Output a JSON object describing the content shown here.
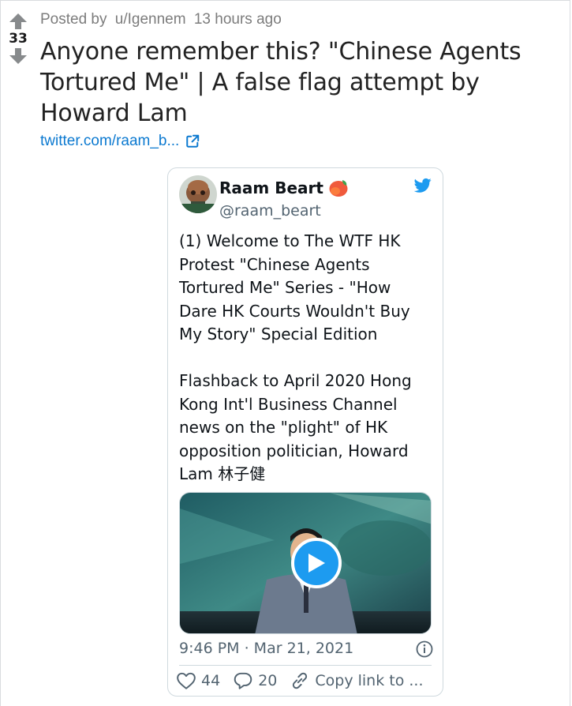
{
  "post": {
    "score": "33",
    "posted_by_prefix": "Posted by",
    "author": "u/Igennem",
    "time_ago": "13 hours ago",
    "title": "Anyone remember this? \"Chinese Agents Tortured Me\" | A false flag attempt by Howard Lam",
    "link_text": "twitter.com/raam_b..."
  },
  "tweet": {
    "author_name": "Raam Beart",
    "author_emoji": "🥭",
    "handle": "@raam_beart",
    "paragraph1": "(1) Welcome to The WTF HK Protest \"Chinese Agents Tortured Me\" Series - \"How Dare HK Courts Wouldn't Buy My Story\" Special Edition",
    "paragraph2": "Flashback to April 2020 Hong Kong Int'l Business Channel news on the \"plight\" of HK opposition politician, Howard Lam 林子健",
    "timestamp": "9:46 PM · Mar 21, 2021",
    "likes": "44",
    "replies": "20",
    "copy_link": "Copy link to ..."
  },
  "colors": {
    "link": "#0b79d0",
    "twitter_blue": "#1d9bf0",
    "muted": "#536471"
  }
}
